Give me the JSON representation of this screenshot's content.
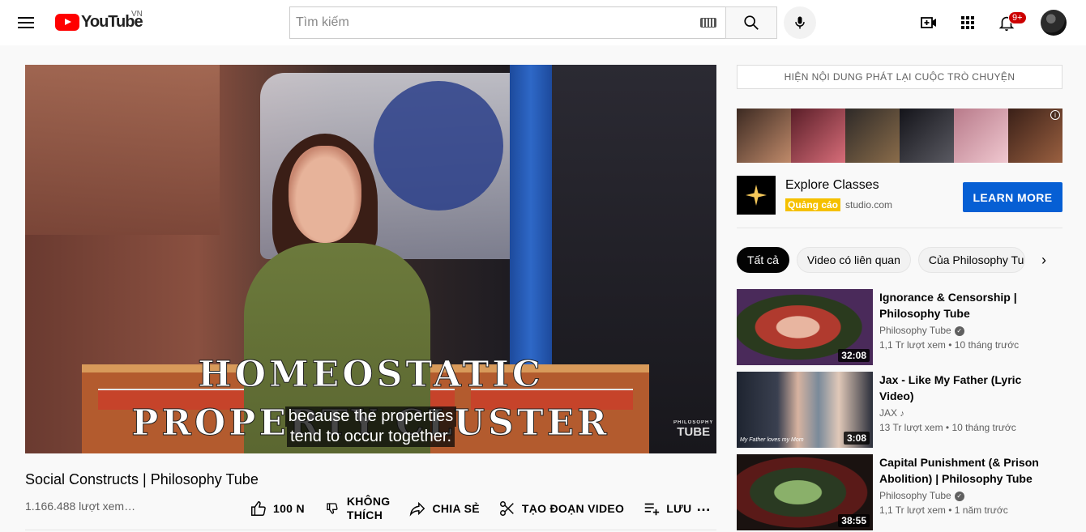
{
  "header": {
    "logo_text": "YouTube",
    "country_code": "VN",
    "search_placeholder": "Tìm kiếm",
    "notifications_badge": "9+"
  },
  "video": {
    "title": "Social Constructs | Philosophy Tube",
    "views": "1.166.488 lượt xem…",
    "caption_line1": "HOMEOSTATIC",
    "caption_line2": "PROPERTY CLUSTER",
    "subtitle_line1": "because the properties",
    "subtitle_line2": "tend to occur together.",
    "watermark_small": "PHILOSOPHY",
    "watermark": "TUBE"
  },
  "actions": {
    "like_count": "100 N",
    "dislike_line1": "KHÔNG",
    "dislike_line2": "THÍCH",
    "share": "CHIA SẺ",
    "clip": "TẠO ĐOẠN VIDEO",
    "save": "LƯU"
  },
  "sidebar": {
    "chat_replay": "HIỆN NỘI DUNG PHÁT LẠI CUỘC TRÒ CHUYỆN",
    "ad": {
      "title": "Explore Classes",
      "badge": "Quảng cáo",
      "url": "studio.com",
      "cta": "LEARN MORE"
    },
    "chips": [
      "Tất cả",
      "Video có liên quan",
      "Của Philosophy Tube"
    ],
    "recommendations": [
      {
        "title": "Ignorance & Censorship | Philosophy Tube",
        "channel": "Philosophy Tube",
        "meta": "1,1 Tr lượt xem • 10 tháng trước",
        "duration": "32:08",
        "verified": true
      },
      {
        "title": "Jax - Like My Father (Lyric Video)",
        "channel": "JAX",
        "meta": "13 Tr lượt xem • 10 tháng trước",
        "duration": "3:08",
        "verified": false,
        "thumb_caption": "My Father loves my Mom"
      },
      {
        "title": "Capital Punishment (& Prison Abolition) | Philosophy Tube",
        "channel": "Philosophy Tube",
        "meta": "1,1 Tr lượt xem • 1 năm trước",
        "duration": "38:55",
        "verified": true
      }
    ]
  },
  "colors": {
    "brand_red": "#ff0000",
    "cta_blue": "#065fd4",
    "ad_badge": "#f5c000"
  }
}
